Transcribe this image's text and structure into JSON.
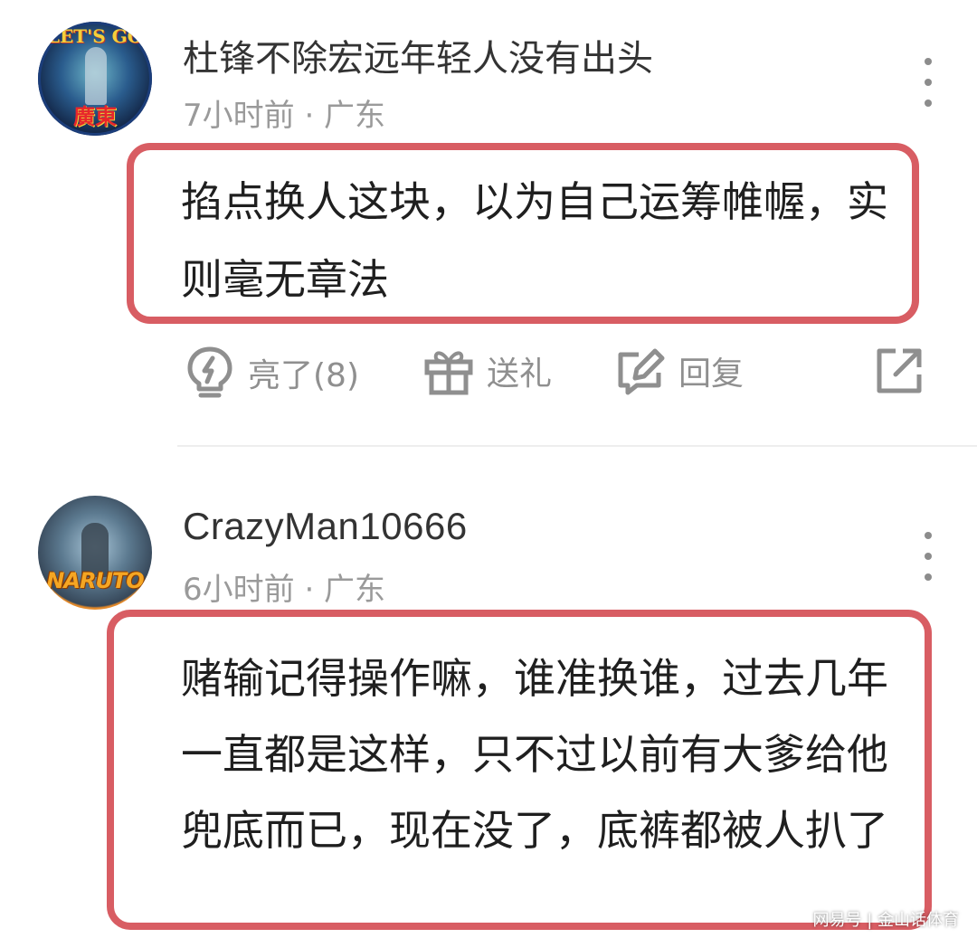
{
  "comments": [
    {
      "avatar": {
        "top_text": "LET'S GO",
        "bottom_text": "廣東"
      },
      "username": "杜锋不除宏远年轻人没有出头",
      "meta": "7小时前 · 广东",
      "body": "掐点换人这块，以为自己运筹帷幄，实则毫无章法",
      "actions": {
        "like_label": "亮了(8)",
        "gift_label": "送礼",
        "reply_label": "回复"
      }
    },
    {
      "avatar": {
        "bottom_text": "NARUTO"
      },
      "username": "CrazyMan10666",
      "meta": "6小时前 · 广东",
      "body": "赌输记得操作嘛，谁准换谁，过去几年一直都是这样，只不过以前有大爹给他兜底而已，现在没了，底裤都被人扒了"
    }
  ],
  "watermark": "网易号 | 金山话体育",
  "colors": {
    "highlight_border": "#d85d63",
    "meta_text": "#9a9a9a",
    "action_icon": "#8f8f8f"
  },
  "icons": {
    "like": "lightbulb-icon",
    "gift": "gift-icon",
    "reply": "edit-reply-icon",
    "share": "share-icon",
    "more": "more-vertical-icon"
  }
}
